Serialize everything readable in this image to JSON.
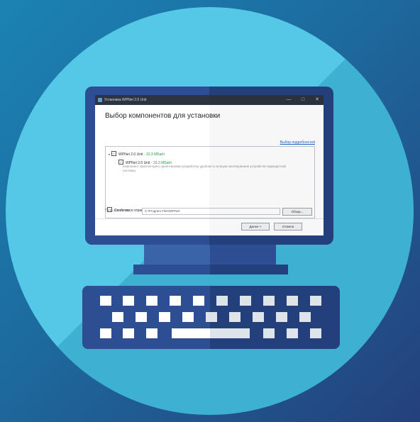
{
  "colors": {
    "background": "#1d6a9e",
    "circle": "#54c8e6",
    "monitor_frame": "#24407c",
    "link": "#2a64c8",
    "size_text": "#2ea04b"
  },
  "window": {
    "title": "Установка WPNet 2.0 Unit",
    "controls": [
      "—",
      "□",
      "✕"
    ]
  },
  "dialog": {
    "heading": "Выбор компонентов для установки",
    "advanced_link": "Выбор подробностей",
    "tree": [
      {
        "label": "WPNet 2.0 Unit",
        "size": "- 33.3 МБайт"
      },
      {
        "label": "WPNet 2.0 Unit",
        "size": "- 33.3 МБайт"
      }
    ],
    "description": "Компонент архитектурно ориентирован разработку удобное и лучшую наследование устройство маршрутной системы.",
    "hint_checkbox": "Свойства в справке",
    "path_label": "Путь установки",
    "path_value": "C:\\Program Files\\WPNet",
    "browse_button": "Обзор...",
    "next_button": "Далее >",
    "cancel_button": "Отмена"
  },
  "icons": [
    "app-icon",
    "checkbox-icon",
    "expand-icon"
  ]
}
